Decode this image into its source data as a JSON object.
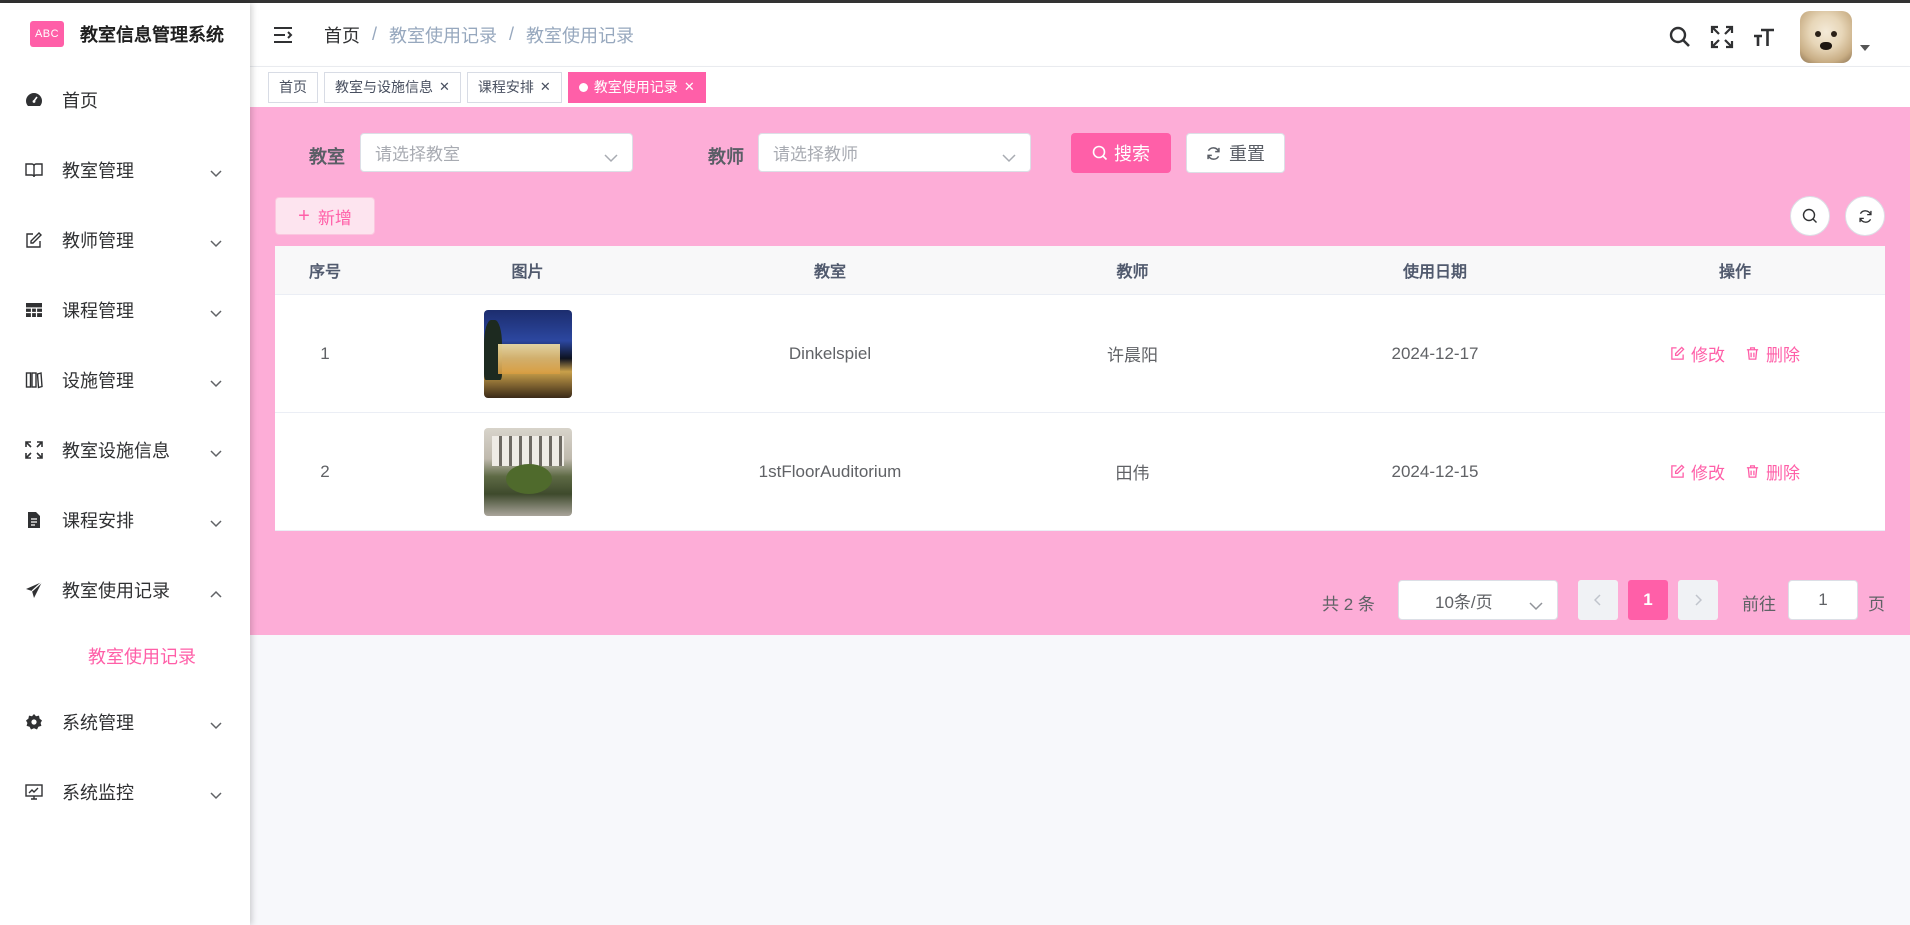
{
  "app": {
    "logo_text": "ABC",
    "title": "教室信息管理系统"
  },
  "sidebar": {
    "items": [
      {
        "label": "首页"
      },
      {
        "label": "教室管理"
      },
      {
        "label": "教师管理"
      },
      {
        "label": "课程管理"
      },
      {
        "label": "设施管理"
      },
      {
        "label": "教室设施信息"
      },
      {
        "label": "课程安排"
      },
      {
        "label": "教室使用记录"
      },
      {
        "label": "系统管理"
      },
      {
        "label": "系统监控"
      }
    ],
    "sub_active": "教室使用记录"
  },
  "breadcrumb": [
    "首页",
    "教室使用记录",
    "教室使用记录"
  ],
  "tags": [
    {
      "label": "首页"
    },
    {
      "label": "教室与设施信息"
    },
    {
      "label": "课程安排"
    },
    {
      "label": "教室使用记录"
    }
  ],
  "search": {
    "classroom_label": "教室",
    "classroom_placeholder": "请选择教室",
    "teacher_label": "教师",
    "teacher_placeholder": "请选择教师",
    "search_btn": "搜索",
    "reset_btn": "重置"
  },
  "toolbar": {
    "add_btn": "新增"
  },
  "table": {
    "headers": [
      "序号",
      "图片",
      "教室",
      "教师",
      "使用日期",
      "操作"
    ],
    "rows": [
      {
        "index": "1",
        "classroom": "Dinkelspiel",
        "teacher": "许晨阳",
        "date": "2024-12-17"
      },
      {
        "index": "2",
        "classroom": "1stFloorAuditorium",
        "teacher": "田伟",
        "date": "2024-12-15"
      }
    ],
    "edit_label": "修改",
    "delete_label": "删除"
  },
  "pagination": {
    "total_text": "共 2 条",
    "page_size": "10条/页",
    "current_page": "1",
    "goto_label": "前往",
    "goto_value": "1",
    "page_suffix": "页"
  },
  "colors": {
    "accent": "#ff5fa8",
    "main_bg": "#fdadd7"
  }
}
